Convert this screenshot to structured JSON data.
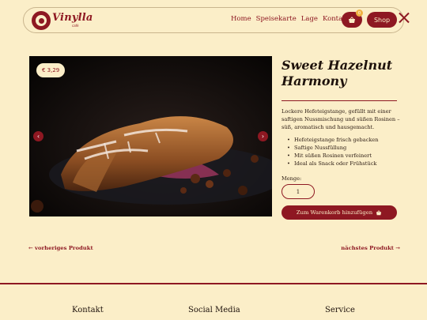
{
  "header": {
    "brand": "Vinylla",
    "brand_sub": "café",
    "nav": [
      "Home",
      "Speisekarte",
      "Lage",
      "Kontakt"
    ],
    "cart_count": "0",
    "shop_label": "Shop"
  },
  "product": {
    "price": "€ 3,29",
    "title": "Sweet Hazelnut Harmony",
    "description": "Lockere Hefeteigstange, gefüllt mit einer saftigen Nussmischung und süßen Rosinen – süß, aromatisch und hausgemacht.",
    "features": [
      "Hefeteigstange frisch gebacken",
      "Saftige Nussfüllung",
      "Mit süßen Rosinen verfeinert",
      "Ideal als Snack oder Frühstück"
    ],
    "qty_label": "Menge:",
    "qty_value": "1",
    "add_to_cart": "Zum Warenkorb hinzufügen"
  },
  "pager": {
    "prev": "← vorheriges Produkt",
    "next": "nächstes Produkt →"
  },
  "footer": {
    "kontakt": "Kontakt",
    "social": "Social Media",
    "service": "Service"
  },
  "colors": {
    "accent": "#8e1822",
    "background": "#fbeec8"
  }
}
